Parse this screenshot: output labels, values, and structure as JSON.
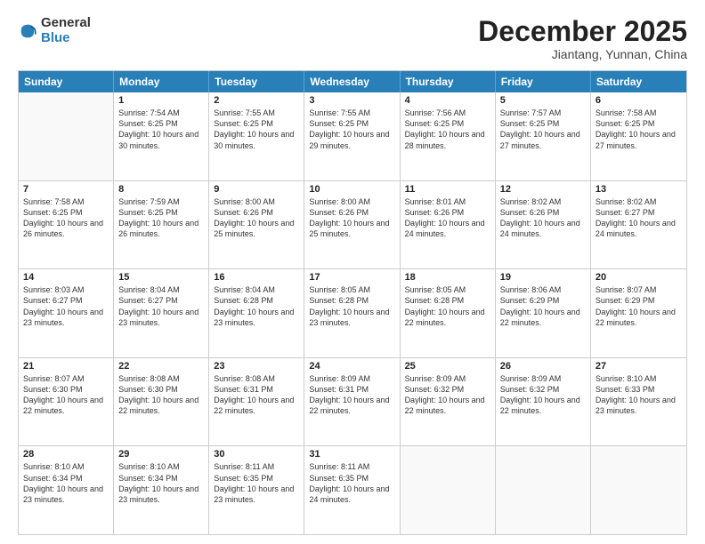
{
  "logo": {
    "general": "General",
    "blue": "Blue"
  },
  "header": {
    "month": "December 2025",
    "location": "Jiantang, Yunnan, China"
  },
  "weekdays": [
    "Sunday",
    "Monday",
    "Tuesday",
    "Wednesday",
    "Thursday",
    "Friday",
    "Saturday"
  ],
  "weeks": [
    [
      {
        "day": "",
        "empty": true
      },
      {
        "day": "1",
        "sunrise": "7:54 AM",
        "sunset": "6:25 PM",
        "daylight": "10 hours and 30 minutes."
      },
      {
        "day": "2",
        "sunrise": "7:55 AM",
        "sunset": "6:25 PM",
        "daylight": "10 hours and 30 minutes."
      },
      {
        "day": "3",
        "sunrise": "7:55 AM",
        "sunset": "6:25 PM",
        "daylight": "10 hours and 29 minutes."
      },
      {
        "day": "4",
        "sunrise": "7:56 AM",
        "sunset": "6:25 PM",
        "daylight": "10 hours and 28 minutes."
      },
      {
        "day": "5",
        "sunrise": "7:57 AM",
        "sunset": "6:25 PM",
        "daylight": "10 hours and 27 minutes."
      },
      {
        "day": "6",
        "sunrise": "7:58 AM",
        "sunset": "6:25 PM",
        "daylight": "10 hours and 27 minutes."
      }
    ],
    [
      {
        "day": "7",
        "sunrise": "7:58 AM",
        "sunset": "6:25 PM",
        "daylight": "10 hours and 26 minutes."
      },
      {
        "day": "8",
        "sunrise": "7:59 AM",
        "sunset": "6:25 PM",
        "daylight": "10 hours and 26 minutes."
      },
      {
        "day": "9",
        "sunrise": "8:00 AM",
        "sunset": "6:26 PM",
        "daylight": "10 hours and 25 minutes."
      },
      {
        "day": "10",
        "sunrise": "8:00 AM",
        "sunset": "6:26 PM",
        "daylight": "10 hours and 25 minutes."
      },
      {
        "day": "11",
        "sunrise": "8:01 AM",
        "sunset": "6:26 PM",
        "daylight": "10 hours and 24 minutes."
      },
      {
        "day": "12",
        "sunrise": "8:02 AM",
        "sunset": "6:26 PM",
        "daylight": "10 hours and 24 minutes."
      },
      {
        "day": "13",
        "sunrise": "8:02 AM",
        "sunset": "6:27 PM",
        "daylight": "10 hours and 24 minutes."
      }
    ],
    [
      {
        "day": "14",
        "sunrise": "8:03 AM",
        "sunset": "6:27 PM",
        "daylight": "10 hours and 23 minutes."
      },
      {
        "day": "15",
        "sunrise": "8:04 AM",
        "sunset": "6:27 PM",
        "daylight": "10 hours and 23 minutes."
      },
      {
        "day": "16",
        "sunrise": "8:04 AM",
        "sunset": "6:28 PM",
        "daylight": "10 hours and 23 minutes."
      },
      {
        "day": "17",
        "sunrise": "8:05 AM",
        "sunset": "6:28 PM",
        "daylight": "10 hours and 23 minutes."
      },
      {
        "day": "18",
        "sunrise": "8:05 AM",
        "sunset": "6:28 PM",
        "daylight": "10 hours and 22 minutes."
      },
      {
        "day": "19",
        "sunrise": "8:06 AM",
        "sunset": "6:29 PM",
        "daylight": "10 hours and 22 minutes."
      },
      {
        "day": "20",
        "sunrise": "8:07 AM",
        "sunset": "6:29 PM",
        "daylight": "10 hours and 22 minutes."
      }
    ],
    [
      {
        "day": "21",
        "sunrise": "8:07 AM",
        "sunset": "6:30 PM",
        "daylight": "10 hours and 22 minutes."
      },
      {
        "day": "22",
        "sunrise": "8:08 AM",
        "sunset": "6:30 PM",
        "daylight": "10 hours and 22 minutes."
      },
      {
        "day": "23",
        "sunrise": "8:08 AM",
        "sunset": "6:31 PM",
        "daylight": "10 hours and 22 minutes."
      },
      {
        "day": "24",
        "sunrise": "8:09 AM",
        "sunset": "6:31 PM",
        "daylight": "10 hours and 22 minutes."
      },
      {
        "day": "25",
        "sunrise": "8:09 AM",
        "sunset": "6:32 PM",
        "daylight": "10 hours and 22 minutes."
      },
      {
        "day": "26",
        "sunrise": "8:09 AM",
        "sunset": "6:32 PM",
        "daylight": "10 hours and 22 minutes."
      },
      {
        "day": "27",
        "sunrise": "8:10 AM",
        "sunset": "6:33 PM",
        "daylight": "10 hours and 23 minutes."
      }
    ],
    [
      {
        "day": "28",
        "sunrise": "8:10 AM",
        "sunset": "6:34 PM",
        "daylight": "10 hours and 23 minutes."
      },
      {
        "day": "29",
        "sunrise": "8:10 AM",
        "sunset": "6:34 PM",
        "daylight": "10 hours and 23 minutes."
      },
      {
        "day": "30",
        "sunrise": "8:11 AM",
        "sunset": "6:35 PM",
        "daylight": "10 hours and 23 minutes."
      },
      {
        "day": "31",
        "sunrise": "8:11 AM",
        "sunset": "6:35 PM",
        "daylight": "10 hours and 24 minutes."
      },
      {
        "day": "",
        "empty": true
      },
      {
        "day": "",
        "empty": true
      },
      {
        "day": "",
        "empty": true
      }
    ]
  ]
}
